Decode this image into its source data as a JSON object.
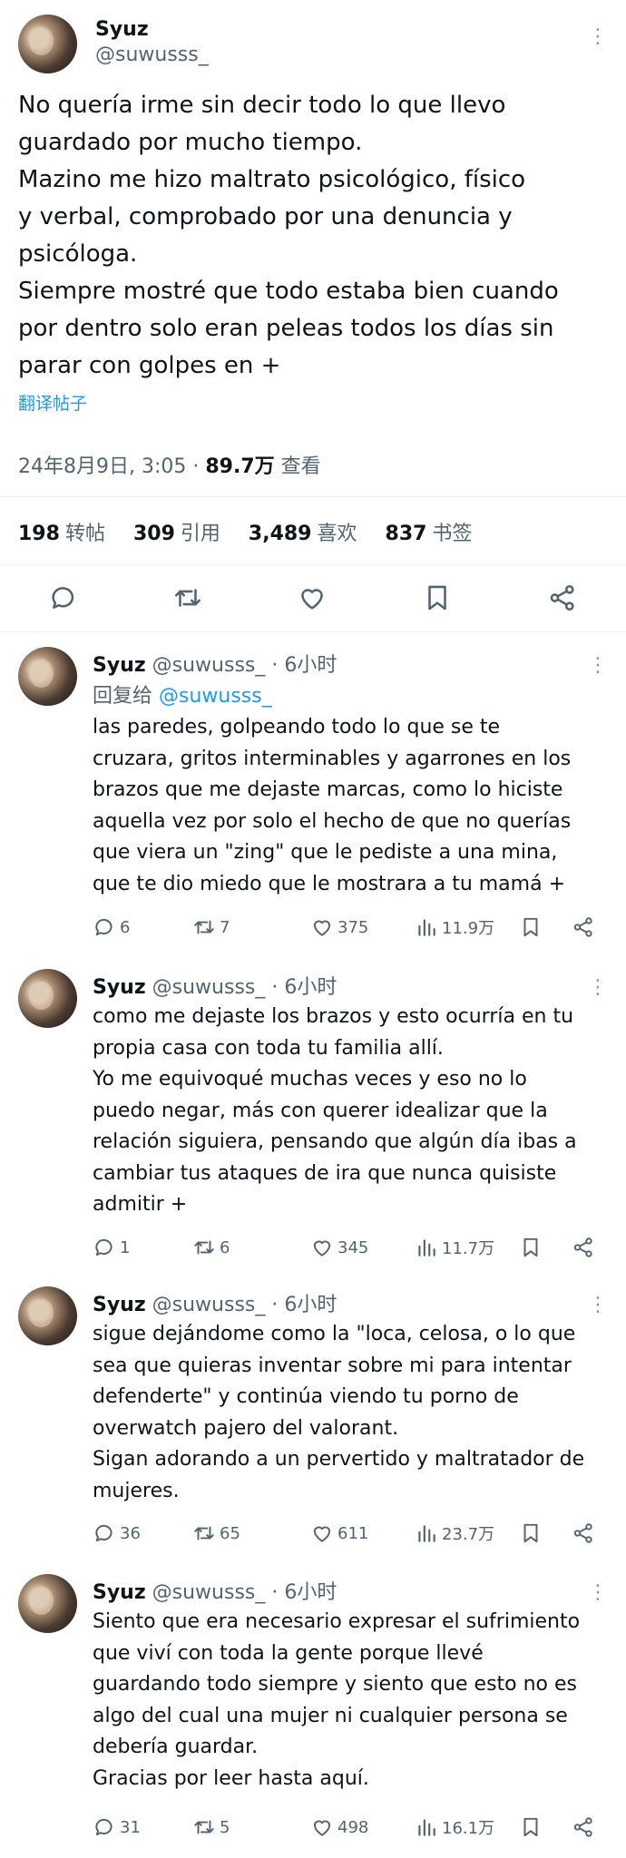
{
  "main": {
    "name": "Syuz",
    "handle": "@suwusss_",
    "more": "⋮",
    "lines": [
      "No quería irme sin decir todo lo que llevo",
      "guardado por mucho tiempo.",
      "Mazino me hizo maltrato psicológico, físico",
      "y verbal, comprobado por una denuncia y",
      "psicóloga.",
      "Siempre mostré que todo estaba bien cuando",
      "por dentro solo eran peleas todos los días sin",
      "parar con golpes en +"
    ],
    "translate": "翻译帖子",
    "date": "24年8月9日, 3:05 · ",
    "views": "89.7万",
    "views_label": " 查看",
    "stats": [
      {
        "num": "198",
        "label": "转帖"
      },
      {
        "num": "309",
        "label": "引用"
      },
      {
        "num": "3,489",
        "label": "喜欢"
      },
      {
        "num": "837",
        "label": "书签"
      }
    ],
    "icons": [
      "reply-icon",
      "retweet-icon",
      "like-icon",
      "bookmark-icon",
      "share-icon"
    ]
  },
  "replies": [
    {
      "name": "Syuz",
      "handle": " @suwusss_ · 6小时",
      "reply_prefix": "回复给 ",
      "reply_to": "@suwusss_",
      "lines": [
        "las paredes, golpeando todo lo que se te",
        "cruzara, gritos interminables y agarrones en los",
        "brazos que me dejaste marcas, como lo hiciste",
        "aquella vez por solo el hecho de que no querías",
        "que viera un \"zing\" que le pediste a una mina,",
        "que te dio miedo que le mostrara a tu mamá +"
      ],
      "replies": "6",
      "retweets": "7",
      "likes": "375",
      "views": "11.9万"
    },
    {
      "name": "Syuz",
      "handle": " @suwusss_ · 6小时",
      "lines": [
        "como me dejaste los brazos y esto ocurría en tu",
        "propia casa con toda tu familia allí.",
        "Yo me equivoqué muchas veces y eso no lo",
        "puedo negar, más con querer idealizar que la",
        "relación siguiera, pensando que algún día ibas a",
        "cambiar tus ataques de ira que nunca quisiste",
        "admitir +"
      ],
      "replies": "1",
      "retweets": "6",
      "likes": "345",
      "views": "11.7万"
    },
    {
      "name": "Syuz",
      "handle": " @suwusss_ · 6小时",
      "lines": [
        "sigue dejándome como la \"loca, celosa, o lo que",
        "sea que quieras inventar sobre mi para intentar",
        "defenderte\" y continúa viendo tu porno de",
        "overwatch pajero del valorant.",
        "Sigan adorando a un pervertido y maltratador de",
        "mujeres."
      ],
      "replies": "36",
      "retweets": "65",
      "likes": "611",
      "views": "23.7万"
    },
    {
      "name": "Syuz",
      "handle": " @suwusss_ · 6小时",
      "lines": [
        "Siento que era necesario expresar el sufrimiento",
        "que viví con toda la gente porque llevé",
        "guardando todo siempre y siento que esto no es",
        "algo del cual una mujer ni cualquier persona se",
        "debería guardar.",
        "Gracias por leer hasta aquí."
      ],
      "replies": "31",
      "retweets": "5",
      "likes": "498",
      "views": "16.1万"
    }
  ]
}
